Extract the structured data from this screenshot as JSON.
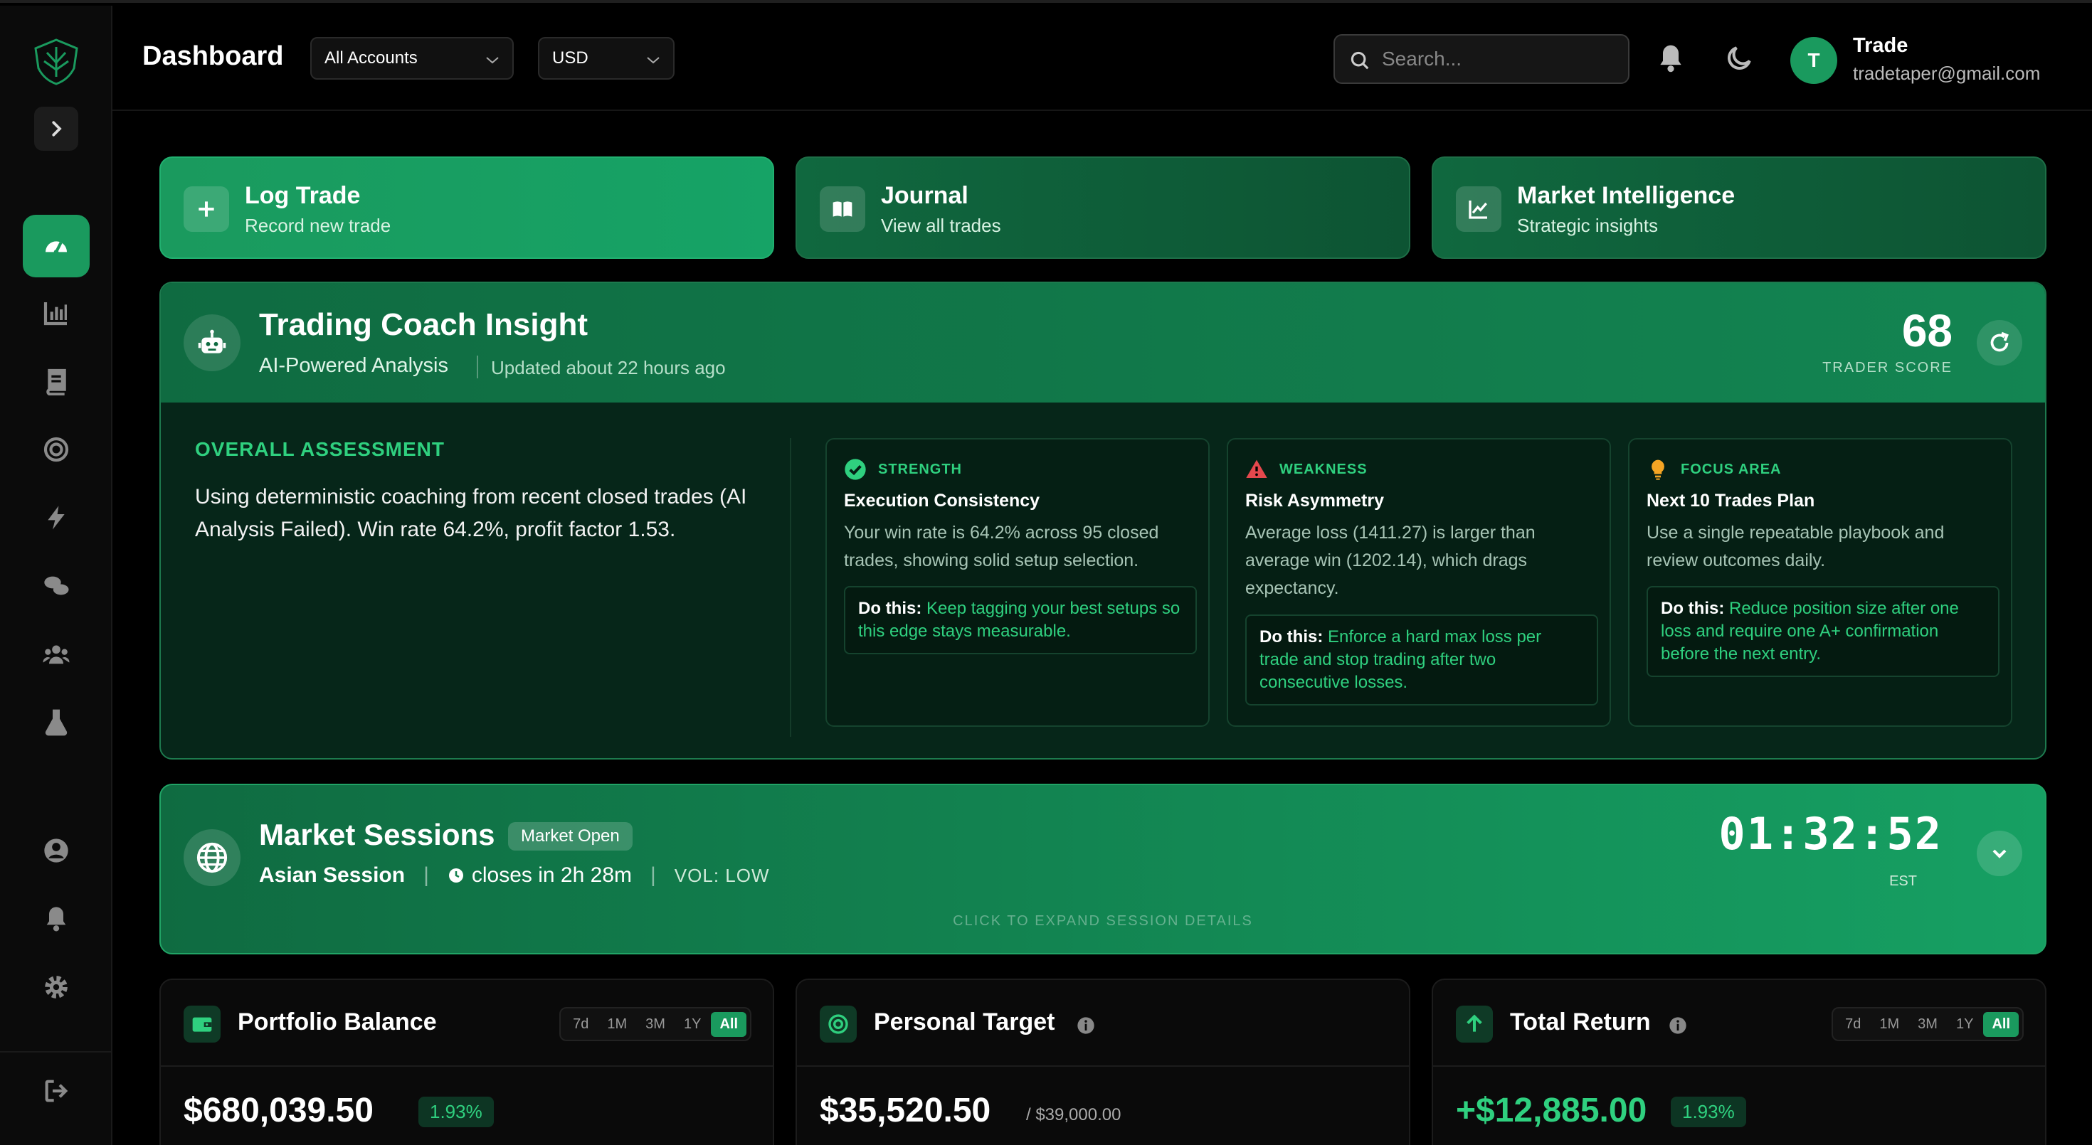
{
  "header": {
    "title": "Dashboard",
    "account_select": "All Accounts",
    "currency_select": "USD",
    "search_placeholder": "Search...",
    "user": {
      "initial": "T",
      "name": "Trade",
      "email": "tradetaper@gmail.com"
    }
  },
  "quick_actions": [
    {
      "title": "Log Trade",
      "subtitle": "Record new trade"
    },
    {
      "title": "Journal",
      "subtitle": "View all trades"
    },
    {
      "title": "Market Intelligence",
      "subtitle": "Strategic insights"
    }
  ],
  "coach": {
    "title": "Trading Coach Insight",
    "subtitle": "AI-Powered Analysis",
    "updated": "Updated about 22 hours ago",
    "score": "68",
    "score_label": "TRADER SCORE",
    "assessment_label": "OVERALL ASSESSMENT",
    "assessment_text": "Using deterministic coaching from recent closed trades (AI Analysis Failed). Win rate 64.2%, profit factor 1.53.",
    "cards": [
      {
        "tag": "STRENGTH",
        "title": "Execution Consistency",
        "text": "Your win rate is 64.2% across 95 closed trades, showing solid setup selection.",
        "do_label": "Do this:",
        "do_text": "Keep tagging your best setups so this edge stays measurable."
      },
      {
        "tag": "WEAKNESS",
        "title": "Risk Asymmetry",
        "text": "Average loss (1411.27) is larger than average win (1202.14), which drags expectancy.",
        "do_label": "Do this:",
        "do_text": "Enforce a hard max loss per trade and stop trading after two consecutive losses."
      },
      {
        "tag": "FOCUS AREA",
        "title": "Next 10 Trades Plan",
        "text": "Use a single repeatable playbook and review outcomes daily.",
        "do_label": "Do this:",
        "do_text": "Reduce position size after one loss and require one A+ confirmation before the next entry."
      }
    ]
  },
  "sessions": {
    "title": "Market Sessions",
    "badge": "Market Open",
    "session_name": "Asian Session",
    "closes": "closes in 2h 28m",
    "volume": "VOL: LOW",
    "time": "01:32:52",
    "timezone": "EST",
    "hint": "CLICK TO EXPAND SESSION DETAILS"
  },
  "stats": {
    "portfolio": {
      "title": "Portfolio Balance",
      "value": "$680,039.50",
      "pct": "1.93%",
      "ranges": [
        "7d",
        "1M",
        "3M",
        "1Y",
        "All"
      ]
    },
    "target": {
      "title": "Personal Target",
      "value": "$35,520.50",
      "of": "/ $39,000.00"
    },
    "return": {
      "title": "Total Return",
      "value": "+$12,885.00",
      "pct": "1.93%",
      "ranges": [
        "7d",
        "1M",
        "3M",
        "1Y",
        "All"
      ]
    }
  },
  "colors": {
    "accent": "#1a9a5e",
    "accent_text": "#2fd07f",
    "weakness": "#e5484d",
    "focus": "#f5a524"
  }
}
